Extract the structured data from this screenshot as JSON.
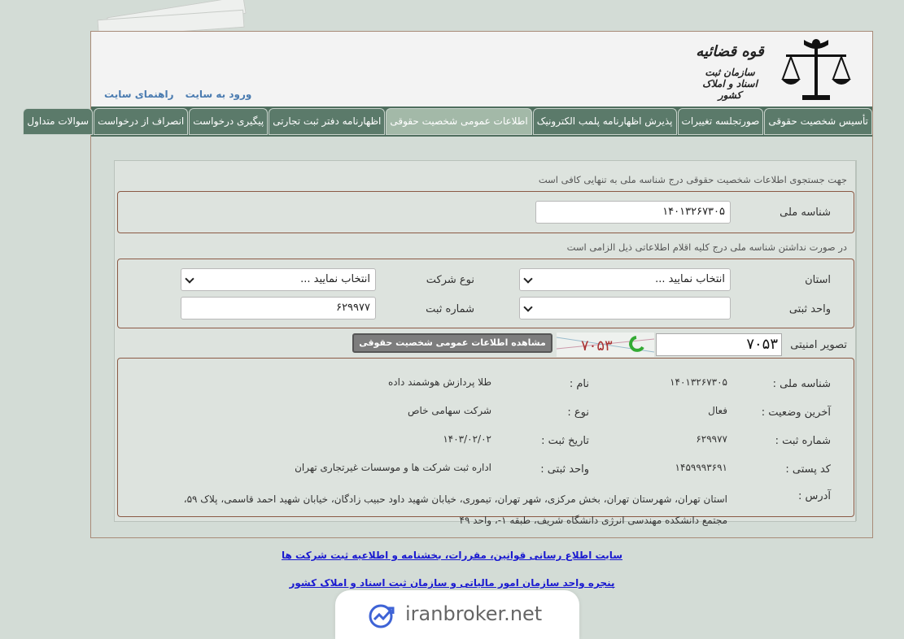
{
  "header": {
    "brand_title": "قوه قضائیه",
    "brand_subtitle": "سازمان ثبت اسناد و املاک کشور",
    "links": [
      "ورود به سایت",
      "راهنمای سایت"
    ]
  },
  "menu": [
    {
      "label": "تأسیس شخصیت حقوقی",
      "active": false
    },
    {
      "label": "صورتجلسه تغییرات",
      "active": false
    },
    {
      "label": "پذیرش اظهارنامه پلمب الکترونیک",
      "active": false
    },
    {
      "label": "اطلاعات عمومی شخصیت حقوقی",
      "active": true
    },
    {
      "label": "اظهارنامه دفتر ثبت تجارتی",
      "active": false
    },
    {
      "label": "پیگیری درخواست",
      "active": false
    },
    {
      "label": "انصراف از درخواست",
      "active": false
    },
    {
      "label": "سوالات متداول",
      "active": false
    }
  ],
  "search": {
    "note1": "جهت جستجوی اطلاعات شخصیت حقوقی درج شناسه ملی به تنهایی کافی است",
    "national_id_label": "شناسه ملی",
    "national_id_value": "۱۴۰۱۳۲۶۷۳۰۵",
    "note2": "در صورت نداشتن شناسه ملی درج کلیه اقلام اطلاعاتی ذیل الزامی است",
    "province_label": "استان",
    "province_value": "انتخاب نمایید ...",
    "company_type_label": "نوع شرکت",
    "company_type_value": "انتخاب نمایید ...",
    "unit_label": "واحد ثبتی",
    "unit_value": "",
    "reg_no_label": "شماره ثبت",
    "reg_no_value": "۶۲۹۹۷۷",
    "captcha_label": "تصویر امنیتی",
    "captcha_value": "۷۰۵۳",
    "captcha_image_text": "۷۰۵۳",
    "submit_label": "مشاهده اطلاعات عمومی شخصیت حقوقی"
  },
  "result": {
    "national_id_label": "شناسه ملی :",
    "national_id": "۱۴۰۱۳۲۶۷۳۰۵",
    "name_label": "نام :",
    "name": "طلا پردازش هوشمند داده",
    "status_label": "آخرین وضعیت :",
    "status": "فعال",
    "type_label": "نوع :",
    "type": "شرکت سهامی خاص",
    "reg_no_label": "شماره ثبت :",
    "reg_no": "۶۲۹۹۷۷",
    "reg_date_label": "تاریخ ثبت :",
    "reg_date": "۱۴۰۳/۰۲/۰۲",
    "postal_label": "کد پستی :",
    "postal": "۱۴۵۹۹۹۳۶۹۱",
    "unit_label": "واحد ثبتی :",
    "unit": "اداره ثبت شرکت ها و موسسات غیرتجاری تهران",
    "address_label": "آدرس :",
    "address": "استان تهران، شهرستان تهران، بخش مرکزی، شهر تهران، تیموری، خیابان شهید داود حبیب زادگان، خیابان شهید احمد قاسمی، پلاک ۵۹، مجتمع دانشکده مهندسی انرژی دانشگاه شریف، طبقه ۱-، واحد ۴۹"
  },
  "footer": {
    "link1": "سایت اطلاع رسانی قوانین، مقررات، بخشنامه و اطلاعیه ثبت شرکت ها",
    "link2": "پنجره واحد سازمان امور مالیاتی و سازمان ثبت اسناد و املاک کشور"
  },
  "watermark": {
    "text": "iranbroker.net"
  },
  "colors": {
    "menubar": "#4f6e5e",
    "active_tab": "#a3b9a8",
    "box_border": "#8b5a45",
    "link": "#1a1ad0"
  }
}
